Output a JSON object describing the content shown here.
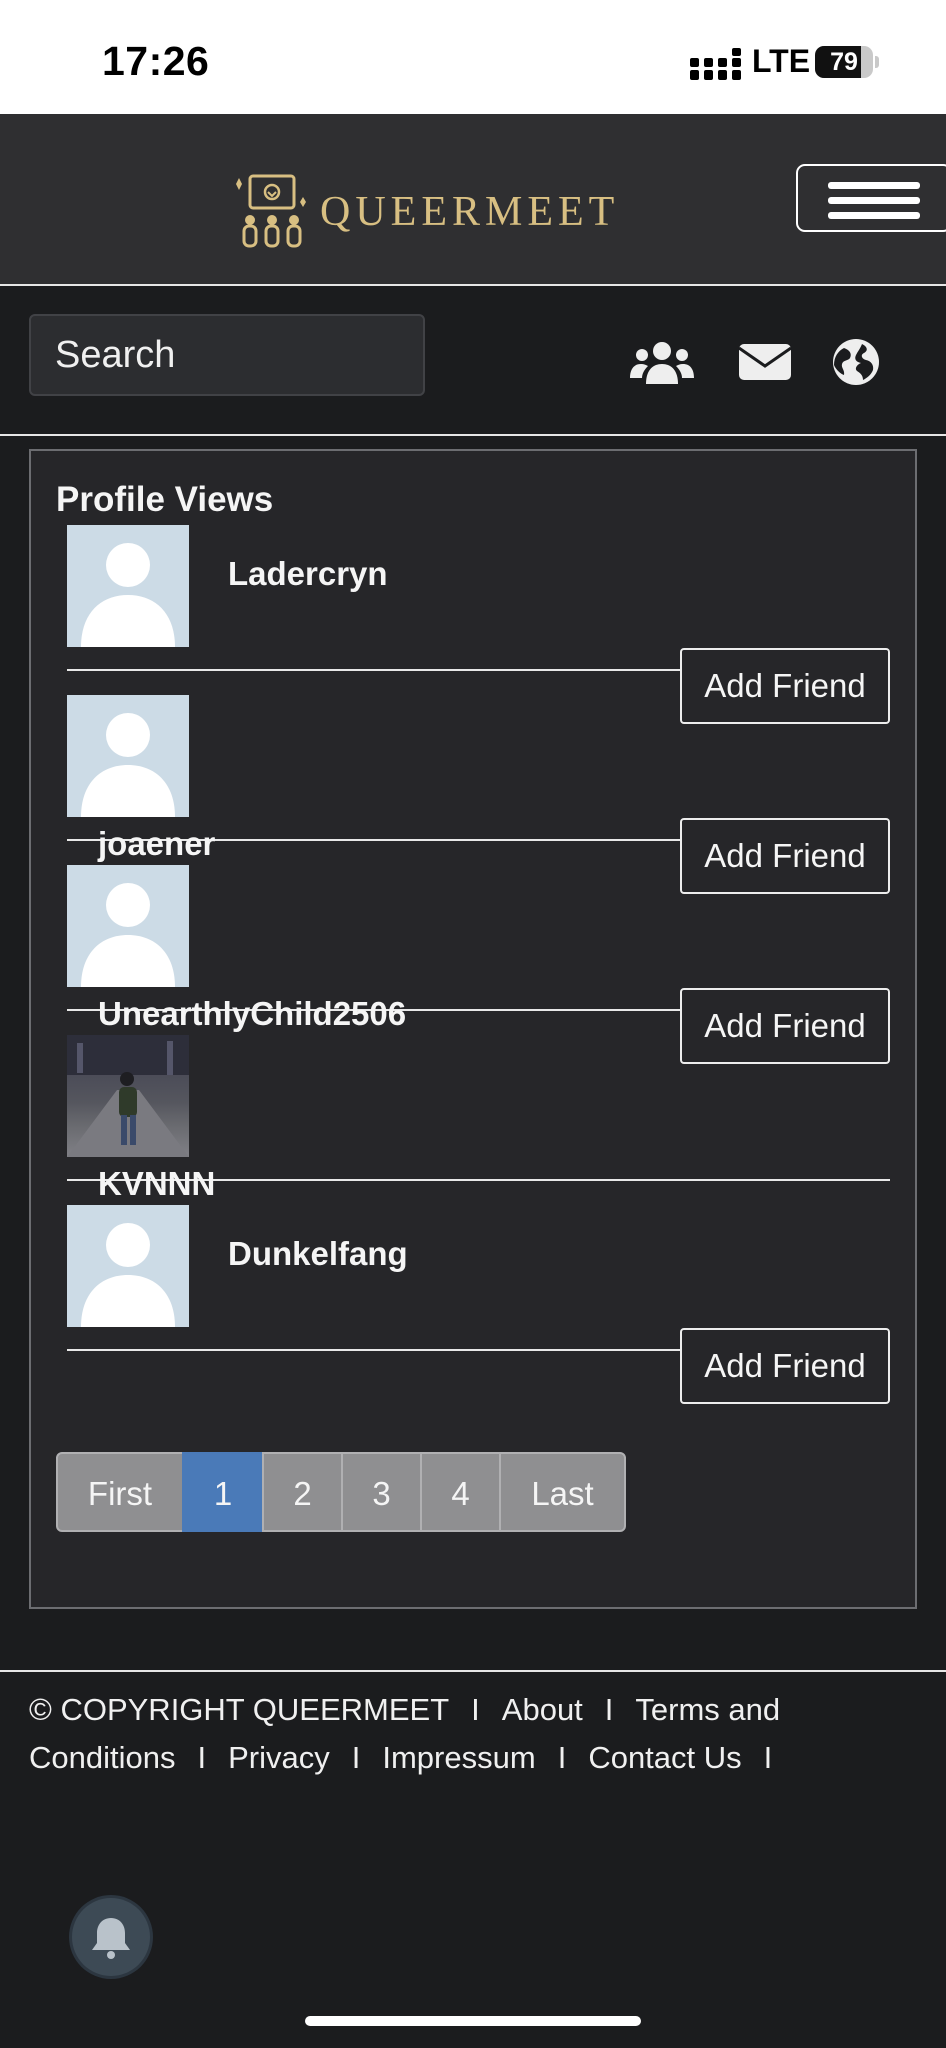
{
  "status_bar": {
    "time": "17:26",
    "network": "LTE",
    "battery": "79",
    "battery_level": 0.79
  },
  "header": {
    "brand": "QUEERMEET",
    "menu_icon": "hamburger-icon"
  },
  "toolbar": {
    "search_placeholder": "Search",
    "icons": [
      "users-icon",
      "envelope-icon",
      "globe-icon"
    ]
  },
  "panel": {
    "title": "Profile Views",
    "users": [
      {
        "name": "Ladercryn",
        "avatar": "default-avatar",
        "action": "Add Friend"
      },
      {
        "name": "joaener",
        "avatar": "default-avatar",
        "action": "Add Friend"
      },
      {
        "name": "UnearthlyChild2506",
        "avatar": "default-avatar",
        "action": "Add Friend"
      },
      {
        "name": "KVNNN",
        "avatar": "photo-avatar",
        "action": ""
      },
      {
        "name": "Dunkelfang",
        "avatar": "default-avatar",
        "action": "Add Friend"
      }
    ]
  },
  "pagination": {
    "first": "First",
    "pages": [
      "1",
      "2",
      "3",
      "4"
    ],
    "last": "Last",
    "current": "1"
  },
  "footer": {
    "copyright": "© COPYRIGHT QUEERMEET",
    "links": [
      "About",
      "Terms and",
      "Conditions",
      "Privacy",
      "Impressum",
      "Contact Us"
    ],
    "separator": "I"
  },
  "colors": {
    "accent": "#4a7ab8",
    "brand_gold": "#d8bf82",
    "background": "#1b1c1e",
    "panel": "#262629"
  }
}
